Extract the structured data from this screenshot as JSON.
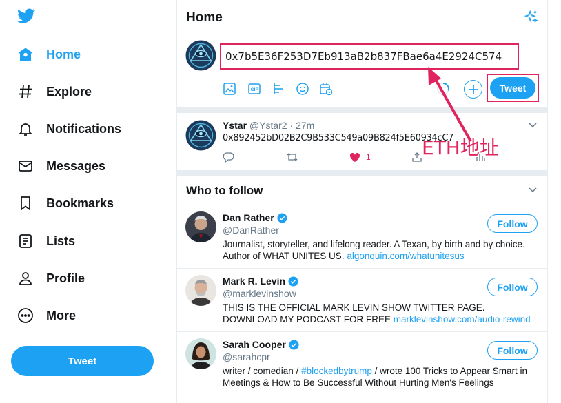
{
  "sidebar": {
    "items": [
      {
        "label": "Home",
        "icon": "home-icon",
        "active": true
      },
      {
        "label": "Explore",
        "icon": "hashtag-icon"
      },
      {
        "label": "Notifications",
        "icon": "bell-icon"
      },
      {
        "label": "Messages",
        "icon": "mail-icon"
      },
      {
        "label": "Bookmarks",
        "icon": "bookmark-icon"
      },
      {
        "label": "Lists",
        "icon": "list-icon"
      },
      {
        "label": "Profile",
        "icon": "user-icon"
      },
      {
        "label": "More",
        "icon": "more-icon"
      }
    ],
    "tweet_label": "Tweet"
  },
  "header": {
    "title": "Home"
  },
  "composer": {
    "value": "0x7b5E36F253D7Eb913aB2b837FBae6a4E2924C574",
    "tweet_label": "Tweet"
  },
  "tweet": {
    "name": "Ystar",
    "handle": "@Ystar2",
    "dot": "·",
    "time": "27m",
    "text": "0x892452bD02B2C9B533C549a09B824f5E60934cC7",
    "likes": "1"
  },
  "who_to_follow": {
    "title": "Who to follow",
    "follow_label": "Follow",
    "users": [
      {
        "name": "Dan Rather",
        "handle": "@DanRather",
        "bio": "Journalist, storyteller, and lifelong reader. A Texan, by birth and by choice. Author of WHAT UNITES US.",
        "link": "algonquin.com/whatunitesus"
      },
      {
        "name": "Mark R. Levin",
        "handle": "@marklevinshow",
        "bio": "THIS IS THE OFFICIAL MARK LEVIN SHOW TWITTER PAGE. DOWNLOAD MY PODCAST FOR FREE",
        "link": "marklevinshow.com/audio-rewind"
      },
      {
        "name": "Sarah Cooper",
        "handle": "@sarahcpr",
        "bio_pre": "writer / comedian /",
        "link": "#blockedbytrump",
        "bio_post": "/ wrote 100 Tricks to Appear Smart in Meetings & How to Be Successful Without Hurting Men's Feelings"
      }
    ]
  },
  "annotation": {
    "text": "ETH地址"
  },
  "colors": {
    "accent": "#1da1f2",
    "highlight": "#e0245e",
    "border": "#e6ecf0",
    "muted": "#657786"
  }
}
